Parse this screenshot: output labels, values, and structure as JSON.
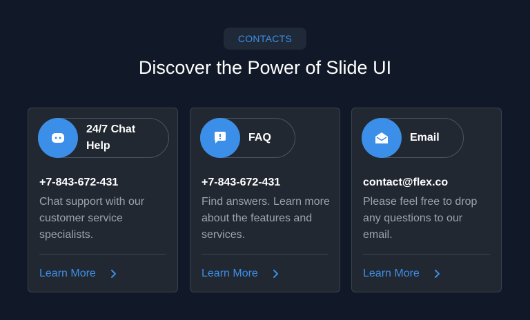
{
  "header": {
    "badge": "CONTACTS",
    "title": "Discover the Power of Slide UI"
  },
  "cards": [
    {
      "icon": "chat-bubble-icon",
      "label": "24/7 Chat Help",
      "contact": "+7-843-672-431",
      "description": "Chat support with our customer service specialists.",
      "link": "Learn More"
    },
    {
      "icon": "faq-message-icon",
      "label": "FAQ",
      "contact": "+7-843-672-431",
      "description": "Find answers. Learn more about the features and services.",
      "link": "Learn More"
    },
    {
      "icon": "envelope-open-icon",
      "label": "Email",
      "contact": "contact@flex.co",
      "description": "Please feel free to drop any questions to our email.",
      "link": "Learn More"
    }
  ],
  "colors": {
    "background": "#111827",
    "card": "#222831",
    "accent": "#3b8fe8"
  }
}
